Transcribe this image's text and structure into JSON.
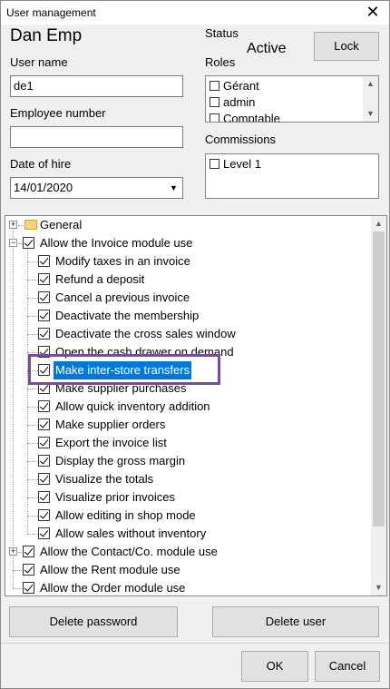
{
  "window": {
    "title": "User management"
  },
  "header": {
    "user_display_name": "Dan Emp"
  },
  "status": {
    "label": "Status",
    "value": "Active",
    "lock_label": "Lock"
  },
  "fields": {
    "user_name_label": "User name",
    "user_name_value": "de1",
    "employee_number_label": "Employee number",
    "employee_number_value": "",
    "date_of_hire_label": "Date of hire",
    "date_of_hire_value": "14/01/2020"
  },
  "roles": {
    "label": "Roles",
    "items": [
      {
        "label": "Gérant",
        "checked": false
      },
      {
        "label": "admin",
        "checked": false
      },
      {
        "label": "Comptable",
        "checked": false
      }
    ]
  },
  "commissions": {
    "label": "Commissions",
    "items": [
      {
        "label": "Level 1",
        "checked": false
      }
    ]
  },
  "permissions": {
    "general": "General",
    "invoice_module": "Allow the Invoice module use",
    "invoice_items": [
      "Modify taxes in an invoice",
      "Refund a deposit",
      "Cancel a previous invoice",
      "Deactivate the membership",
      "Deactivate the cross sales window",
      "Open the cash drawer on demand",
      "Make inter-store transfers",
      "Make supplier purchases",
      "Allow quick inventory addition",
      "Make supplier orders",
      "Export the invoice list",
      "Display the gross margin",
      "Visualize the totals",
      "Visualize prior invoices",
      "Allow editing in shop mode",
      "Allow sales without inventory"
    ],
    "selected_item": "Make inter-store transfers",
    "contact_module": "Allow the Contact/Co. module use",
    "rent_module": "Allow the Rent module use",
    "order_module": "Allow the Order module use"
  },
  "actions": {
    "delete_password": "Delete password",
    "delete_user": "Delete user",
    "ok": "OK",
    "cancel": "Cancel"
  },
  "colors": {
    "selection": "#0078d7",
    "focus_outline": "#7d4a96"
  }
}
